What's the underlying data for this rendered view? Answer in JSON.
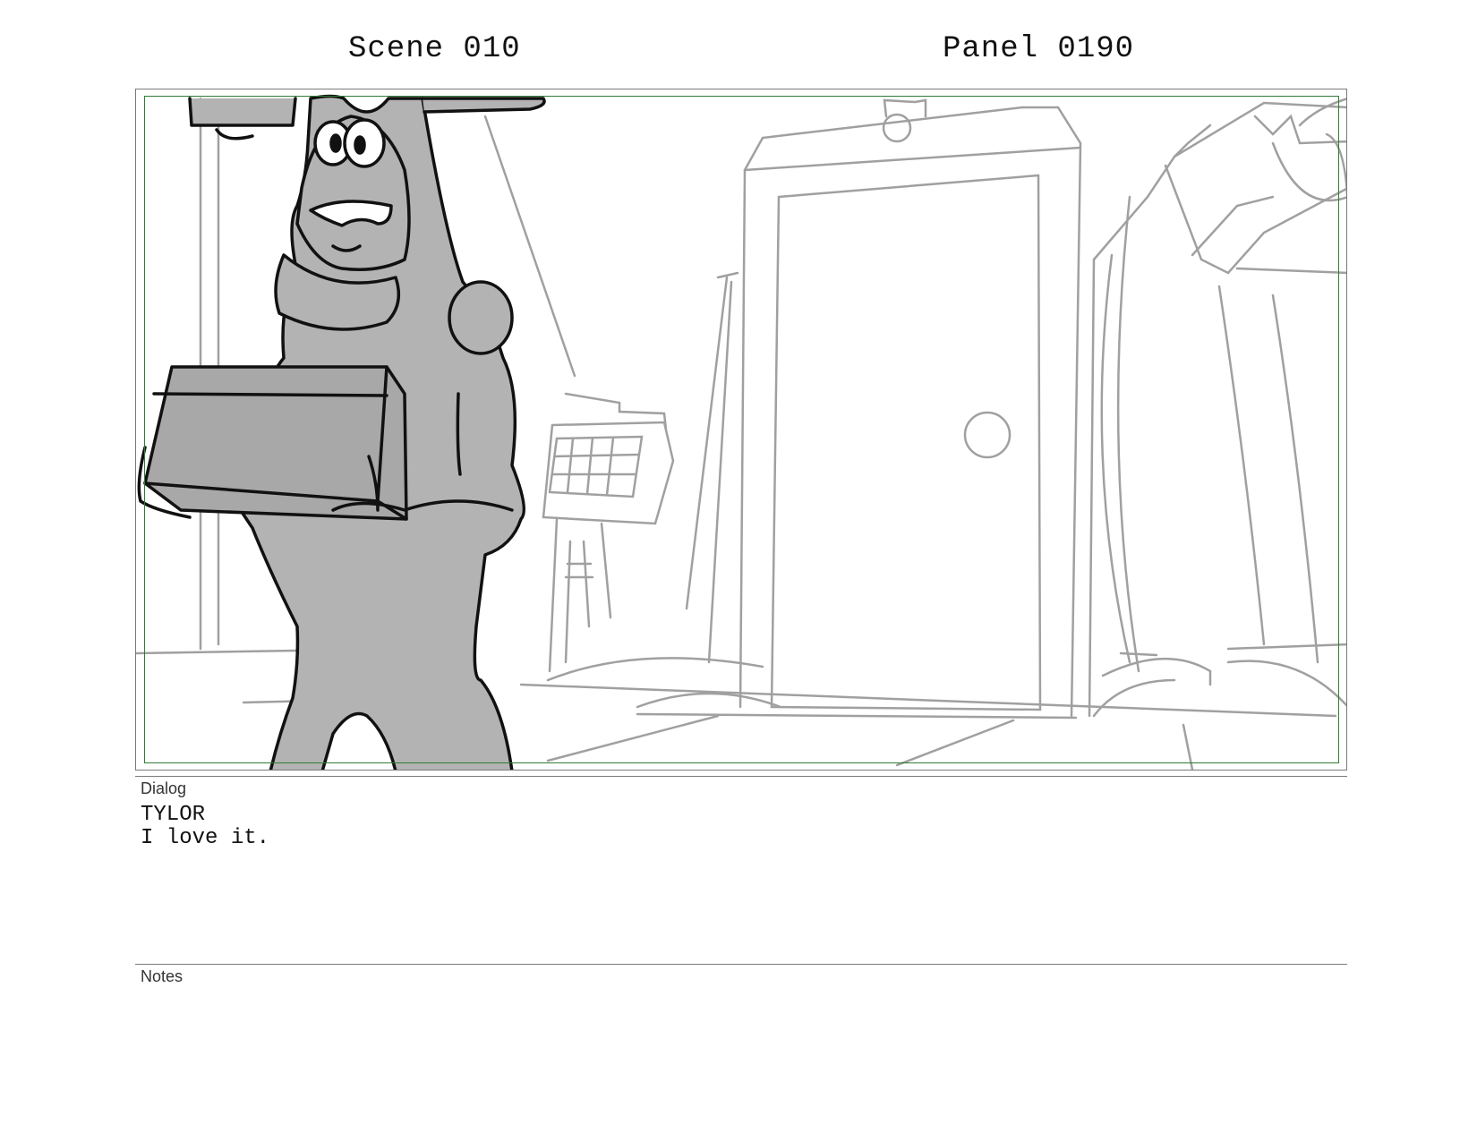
{
  "header": {
    "scene": "Scene 010",
    "panel": "Panel 0190"
  },
  "dialog": {
    "label": "Dialog",
    "speaker": "TYLOR",
    "line": "I love it."
  },
  "notes": {
    "label": "Notes"
  },
  "colors": {
    "safe_frame": "#2e7d32",
    "character_fill": "#b3b3b3",
    "background_lines": "#9a9a9a"
  }
}
